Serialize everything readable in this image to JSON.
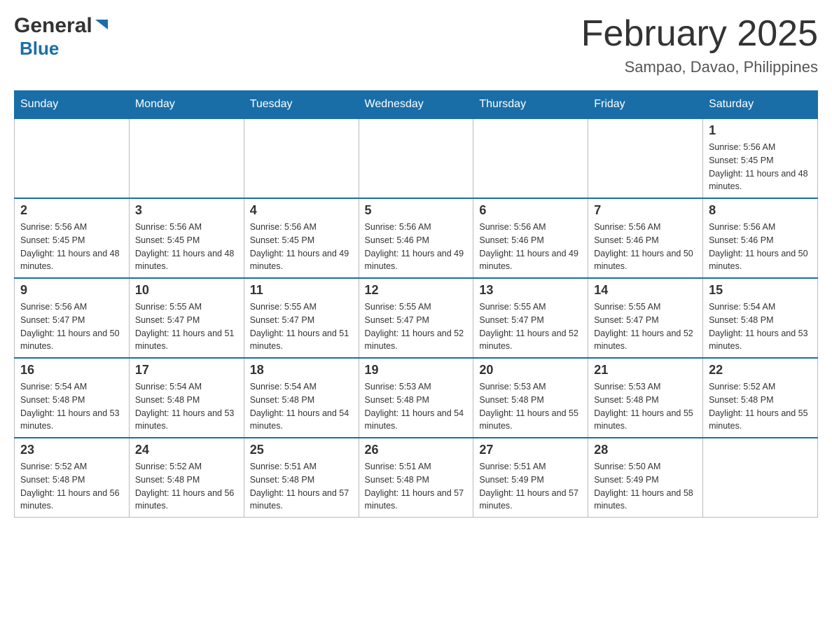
{
  "header": {
    "logo_general": "General",
    "logo_blue": "Blue",
    "month_title": "February 2025",
    "location": "Sampao, Davao, Philippines"
  },
  "days_of_week": [
    "Sunday",
    "Monday",
    "Tuesday",
    "Wednesday",
    "Thursday",
    "Friday",
    "Saturday"
  ],
  "weeks": [
    {
      "days": [
        {
          "number": "",
          "sunrise": "",
          "sunset": "",
          "daylight": "",
          "empty": true
        },
        {
          "number": "",
          "sunrise": "",
          "sunset": "",
          "daylight": "",
          "empty": true
        },
        {
          "number": "",
          "sunrise": "",
          "sunset": "",
          "daylight": "",
          "empty": true
        },
        {
          "number": "",
          "sunrise": "",
          "sunset": "",
          "daylight": "",
          "empty": true
        },
        {
          "number": "",
          "sunrise": "",
          "sunset": "",
          "daylight": "",
          "empty": true
        },
        {
          "number": "",
          "sunrise": "",
          "sunset": "",
          "daylight": "",
          "empty": true
        },
        {
          "number": "1",
          "sunrise": "Sunrise: 5:56 AM",
          "sunset": "Sunset: 5:45 PM",
          "daylight": "Daylight: 11 hours and 48 minutes.",
          "empty": false
        }
      ]
    },
    {
      "days": [
        {
          "number": "2",
          "sunrise": "Sunrise: 5:56 AM",
          "sunset": "Sunset: 5:45 PM",
          "daylight": "Daylight: 11 hours and 48 minutes.",
          "empty": false
        },
        {
          "number": "3",
          "sunrise": "Sunrise: 5:56 AM",
          "sunset": "Sunset: 5:45 PM",
          "daylight": "Daylight: 11 hours and 48 minutes.",
          "empty": false
        },
        {
          "number": "4",
          "sunrise": "Sunrise: 5:56 AM",
          "sunset": "Sunset: 5:45 PM",
          "daylight": "Daylight: 11 hours and 49 minutes.",
          "empty": false
        },
        {
          "number": "5",
          "sunrise": "Sunrise: 5:56 AM",
          "sunset": "Sunset: 5:46 PM",
          "daylight": "Daylight: 11 hours and 49 minutes.",
          "empty": false
        },
        {
          "number": "6",
          "sunrise": "Sunrise: 5:56 AM",
          "sunset": "Sunset: 5:46 PM",
          "daylight": "Daylight: 11 hours and 49 minutes.",
          "empty": false
        },
        {
          "number": "7",
          "sunrise": "Sunrise: 5:56 AM",
          "sunset": "Sunset: 5:46 PM",
          "daylight": "Daylight: 11 hours and 50 minutes.",
          "empty": false
        },
        {
          "number": "8",
          "sunrise": "Sunrise: 5:56 AM",
          "sunset": "Sunset: 5:46 PM",
          "daylight": "Daylight: 11 hours and 50 minutes.",
          "empty": false
        }
      ]
    },
    {
      "days": [
        {
          "number": "9",
          "sunrise": "Sunrise: 5:56 AM",
          "sunset": "Sunset: 5:47 PM",
          "daylight": "Daylight: 11 hours and 50 minutes.",
          "empty": false
        },
        {
          "number": "10",
          "sunrise": "Sunrise: 5:55 AM",
          "sunset": "Sunset: 5:47 PM",
          "daylight": "Daylight: 11 hours and 51 minutes.",
          "empty": false
        },
        {
          "number": "11",
          "sunrise": "Sunrise: 5:55 AM",
          "sunset": "Sunset: 5:47 PM",
          "daylight": "Daylight: 11 hours and 51 minutes.",
          "empty": false
        },
        {
          "number": "12",
          "sunrise": "Sunrise: 5:55 AM",
          "sunset": "Sunset: 5:47 PM",
          "daylight": "Daylight: 11 hours and 52 minutes.",
          "empty": false
        },
        {
          "number": "13",
          "sunrise": "Sunrise: 5:55 AM",
          "sunset": "Sunset: 5:47 PM",
          "daylight": "Daylight: 11 hours and 52 minutes.",
          "empty": false
        },
        {
          "number": "14",
          "sunrise": "Sunrise: 5:55 AM",
          "sunset": "Sunset: 5:47 PM",
          "daylight": "Daylight: 11 hours and 52 minutes.",
          "empty": false
        },
        {
          "number": "15",
          "sunrise": "Sunrise: 5:54 AM",
          "sunset": "Sunset: 5:48 PM",
          "daylight": "Daylight: 11 hours and 53 minutes.",
          "empty": false
        }
      ]
    },
    {
      "days": [
        {
          "number": "16",
          "sunrise": "Sunrise: 5:54 AM",
          "sunset": "Sunset: 5:48 PM",
          "daylight": "Daylight: 11 hours and 53 minutes.",
          "empty": false
        },
        {
          "number": "17",
          "sunrise": "Sunrise: 5:54 AM",
          "sunset": "Sunset: 5:48 PM",
          "daylight": "Daylight: 11 hours and 53 minutes.",
          "empty": false
        },
        {
          "number": "18",
          "sunrise": "Sunrise: 5:54 AM",
          "sunset": "Sunset: 5:48 PM",
          "daylight": "Daylight: 11 hours and 54 minutes.",
          "empty": false
        },
        {
          "number": "19",
          "sunrise": "Sunrise: 5:53 AM",
          "sunset": "Sunset: 5:48 PM",
          "daylight": "Daylight: 11 hours and 54 minutes.",
          "empty": false
        },
        {
          "number": "20",
          "sunrise": "Sunrise: 5:53 AM",
          "sunset": "Sunset: 5:48 PM",
          "daylight": "Daylight: 11 hours and 55 minutes.",
          "empty": false
        },
        {
          "number": "21",
          "sunrise": "Sunrise: 5:53 AM",
          "sunset": "Sunset: 5:48 PM",
          "daylight": "Daylight: 11 hours and 55 minutes.",
          "empty": false
        },
        {
          "number": "22",
          "sunrise": "Sunrise: 5:52 AM",
          "sunset": "Sunset: 5:48 PM",
          "daylight": "Daylight: 11 hours and 55 minutes.",
          "empty": false
        }
      ]
    },
    {
      "days": [
        {
          "number": "23",
          "sunrise": "Sunrise: 5:52 AM",
          "sunset": "Sunset: 5:48 PM",
          "daylight": "Daylight: 11 hours and 56 minutes.",
          "empty": false
        },
        {
          "number": "24",
          "sunrise": "Sunrise: 5:52 AM",
          "sunset": "Sunset: 5:48 PM",
          "daylight": "Daylight: 11 hours and 56 minutes.",
          "empty": false
        },
        {
          "number": "25",
          "sunrise": "Sunrise: 5:51 AM",
          "sunset": "Sunset: 5:48 PM",
          "daylight": "Daylight: 11 hours and 57 minutes.",
          "empty": false
        },
        {
          "number": "26",
          "sunrise": "Sunrise: 5:51 AM",
          "sunset": "Sunset: 5:48 PM",
          "daylight": "Daylight: 11 hours and 57 minutes.",
          "empty": false
        },
        {
          "number": "27",
          "sunrise": "Sunrise: 5:51 AM",
          "sunset": "Sunset: 5:49 PM",
          "daylight": "Daylight: 11 hours and 57 minutes.",
          "empty": false
        },
        {
          "number": "28",
          "sunrise": "Sunrise: 5:50 AM",
          "sunset": "Sunset: 5:49 PM",
          "daylight": "Daylight: 11 hours and 58 minutes.",
          "empty": false
        },
        {
          "number": "",
          "sunrise": "",
          "sunset": "",
          "daylight": "",
          "empty": true
        }
      ]
    }
  ]
}
